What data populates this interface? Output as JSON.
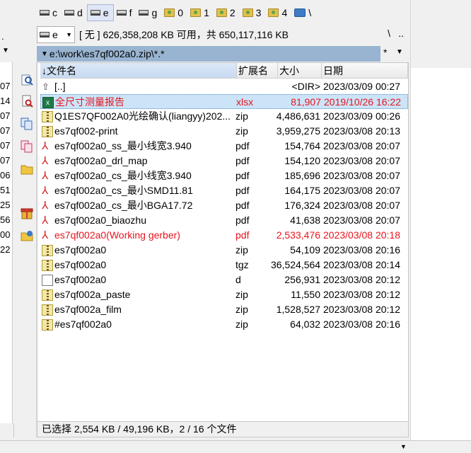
{
  "left_panel": {
    "top_fragment": ".",
    "drop_arrow": "▼",
    "size_fragments": [
      "07",
      "14",
      "07",
      "07",
      "07",
      "07",
      "06",
      "51",
      "25",
      "56",
      "00",
      "22"
    ]
  },
  "drives": [
    {
      "letter": "c",
      "icon": "hard-drive-icon",
      "active": false
    },
    {
      "letter": "d",
      "icon": "hard-drive-icon",
      "active": false
    },
    {
      "letter": "e",
      "icon": "hard-drive-icon",
      "active": true
    },
    {
      "letter": "f",
      "icon": "hard-drive-icon",
      "active": false
    },
    {
      "letter": "g",
      "icon": "hard-drive-icon",
      "active": false
    },
    {
      "letter": "0",
      "icon": "folder-drive-icon",
      "active": false
    },
    {
      "letter": "1",
      "icon": "folder-drive-icon",
      "active": false
    },
    {
      "letter": "2",
      "icon": "folder-drive-icon",
      "active": false
    },
    {
      "letter": "3",
      "icon": "folder-drive-icon",
      "active": false
    },
    {
      "letter": "4",
      "icon": "folder-drive-icon",
      "active": false
    },
    {
      "letter": "\\",
      "icon": "network-icon",
      "active": false
    }
  ],
  "info_bar": {
    "drive_value": "e",
    "free_space": "[ 无 ]  626,358,208 KB 可用，共 650,117,116 KB",
    "root_label": "\\",
    "up_label": ".."
  },
  "path": {
    "value": "e:\\work\\es7qf002a0.zip\\*.*",
    "history_label": "*",
    "history_arrow": "▼"
  },
  "columns": {
    "name": "↓文件名",
    "ext": "扩展名",
    "size": "大小",
    "date": "日期"
  },
  "rows": [
    {
      "icon": "up",
      "name": "[..]",
      "ext": "",
      "size": "<DIR>",
      "date": "2023/03/09 00:27",
      "state": ""
    },
    {
      "icon": "xlsx",
      "name": "全尺寸测量报告",
      "ext": "xlsx",
      "size": "81,907",
      "date": "2019/10/26 16:22",
      "state": "cursor marked"
    },
    {
      "icon": "zip",
      "name": "Q1ES7QF002A0光绘确认(liangyy)202...",
      "ext": "zip",
      "size": "4,486,631",
      "date": "2023/03/09 00:26",
      "state": ""
    },
    {
      "icon": "zip",
      "name": "es7qf002-print",
      "ext": "zip",
      "size": "3,959,275",
      "date": "2023/03/08 20:13",
      "state": ""
    },
    {
      "icon": "pdf",
      "name": "es7qf002a0_ss_最小线宽3.940",
      "ext": "pdf",
      "size": "154,764",
      "date": "2023/03/08 20:07",
      "state": ""
    },
    {
      "icon": "pdf",
      "name": "es7qf002a0_drl_map",
      "ext": "pdf",
      "size": "154,120",
      "date": "2023/03/08 20:07",
      "state": ""
    },
    {
      "icon": "pdf",
      "name": "es7qf002a0_cs_最小线宽3.940",
      "ext": "pdf",
      "size": "185,696",
      "date": "2023/03/08 20:07",
      "state": ""
    },
    {
      "icon": "pdf",
      "name": "es7qf002a0_cs_最小SMD11.81",
      "ext": "pdf",
      "size": "164,175",
      "date": "2023/03/08 20:07",
      "state": ""
    },
    {
      "icon": "pdf",
      "name": "es7qf002a0_cs_最小BGA17.72",
      "ext": "pdf",
      "size": "176,324",
      "date": "2023/03/08 20:07",
      "state": ""
    },
    {
      "icon": "pdf",
      "name": "es7qf002a0_biaozhu",
      "ext": "pdf",
      "size": "41,638",
      "date": "2023/03/08 20:07",
      "state": ""
    },
    {
      "icon": "pdf",
      "name": "es7qf002a0(Working gerber)",
      "ext": "pdf",
      "size": "2,533,476",
      "date": "2023/03/08 20:18",
      "state": "marked"
    },
    {
      "icon": "zip",
      "name": "es7qf002a0",
      "ext": "zip",
      "size": "54,109",
      "date": "2023/03/08 20:16",
      "state": ""
    },
    {
      "icon": "zip",
      "name": "es7qf002a0",
      "ext": "tgz",
      "size": "36,524,564",
      "date": "2023/03/08 20:14",
      "state": ""
    },
    {
      "icon": "file",
      "name": "es7qf002a0",
      "ext": "d",
      "size": "256,931",
      "date": "2023/03/08 20:12",
      "state": ""
    },
    {
      "icon": "zip",
      "name": "es7qf002a_paste",
      "ext": "zip",
      "size": "11,550",
      "date": "2023/03/08 20:12",
      "state": ""
    },
    {
      "icon": "zip",
      "name": "es7qf002a_film",
      "ext": "zip",
      "size": "1,528,527",
      "date": "2023/03/08 20:12",
      "state": ""
    },
    {
      "icon": "zip",
      "name": "#es7qf002a0",
      "ext": "zip",
      "size": "64,032",
      "date": "2023/03/08 20:16",
      "state": ""
    }
  ],
  "status": "已选择 2,554 KB / 49,196 KB，2 / 16 个文件",
  "colors": {
    "path_bar": "#99b4d1",
    "marked_text": "#e8141e",
    "cursor_row": "#cce4f7"
  },
  "toolbar_icons": [
    "find-files-icon",
    "view-file-icon",
    "copy-files-icon",
    "compare-files-icon",
    "new-folder-icon",
    "pack-files-icon",
    "unpack-files-icon"
  ],
  "bottom_arrow": "▼"
}
